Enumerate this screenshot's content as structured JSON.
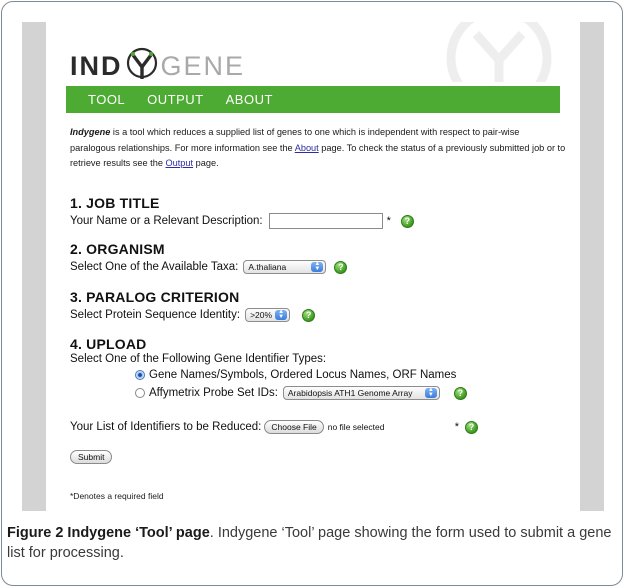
{
  "logo": {
    "prefix": "IND",
    "suffix": "GENE"
  },
  "nav": {
    "tabs": [
      "TOOL",
      "OUTPUT",
      "ABOUT"
    ]
  },
  "intro": {
    "brand": "Indygene",
    "text1": " is a tool which reduces a supplied list of genes to one which is independent with respect to pair-wise paralogous relationships. For more information see the ",
    "about_link": "About",
    "text2": " page. To check the status of a previously submitted job or to retrieve results see the ",
    "output_link": "Output",
    "text3": " page."
  },
  "job_title": {
    "heading": "1. JOB TITLE",
    "label": "Your Name or a Relevant Description:",
    "value": "",
    "required_mark": "*"
  },
  "organism": {
    "heading": "2. ORGANISM",
    "label": "Select One of the Available Taxa:",
    "selected": "A.thaliana"
  },
  "paralog": {
    "heading": "3. PARALOG CRITERION",
    "label": "Select Protein Sequence Identity:",
    "selected": ">20%"
  },
  "upload": {
    "heading": "4. UPLOAD",
    "label": "Select One of the Following Gene Identifier Types:",
    "option1": "Gene Names/Symbols, Ordered Locus Names, ORF Names",
    "option2": "Affymetrix Probe Set IDs:",
    "array_selected": "Arabidopsis ATH1 Genome Array",
    "list_label": "Your List of Identifiers to be Reduced:",
    "choose_file": "Choose File",
    "file_status": "no file selected",
    "required_mark": "*"
  },
  "submit_label": "Submit",
  "footnote": "*Denotes a required field",
  "caption": {
    "bold": "Figure 2 Indygene ‘Tool’ page",
    "text": ". Indygene ‘Tool’ page showing the form used to submit a gene list for processing."
  },
  "colors": {
    "nav_green": "#4dab33",
    "help_green": "#3d9a21",
    "side_grey": "#d3d3d3"
  },
  "icons": {
    "help": "help-icon",
    "select_arrows": "select-arrows-icon"
  }
}
